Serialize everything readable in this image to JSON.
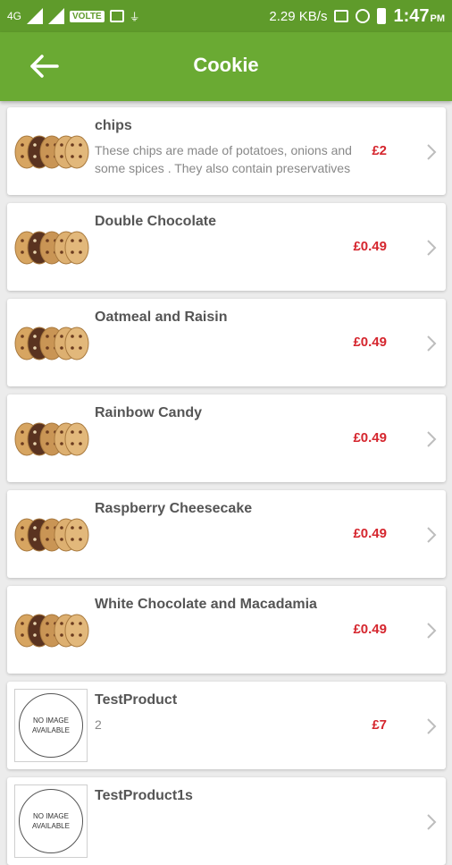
{
  "status_bar": {
    "network": "4G",
    "volte": "VOLTE",
    "speed": "2.29 KB/s",
    "time": "1:47",
    "ampm": "PM"
  },
  "app_bar": {
    "title": "Cookie"
  },
  "products": [
    {
      "name": "chips",
      "description": "These chips are made of potatoes, onions and some spices . They also contain preservatives",
      "price": "£2",
      "image": "cookie"
    },
    {
      "name": "Double Chocolate",
      "description": "",
      "price": "£0.49",
      "image": "cookie"
    },
    {
      "name": "Oatmeal and Raisin",
      "description": "",
      "price": "£0.49",
      "image": "cookie"
    },
    {
      "name": "Rainbow Candy",
      "description": "",
      "price": "£0.49",
      "image": "cookie"
    },
    {
      "name": "Raspberry Cheesecake",
      "description": "",
      "price": "£0.49",
      "image": "cookie"
    },
    {
      "name": "White Chocolate and Macadamia",
      "description": "",
      "price": "£0.49",
      "image": "cookie"
    },
    {
      "name": "TestProduct",
      "description": "2",
      "price": "£7",
      "image": "no-image"
    },
    {
      "name": "TestProduct1s",
      "description": "",
      "price": "",
      "image": "no-image"
    }
  ],
  "no_image_label": "NO IMAGE AVAILABLE",
  "colors": {
    "accent": "#6aaa33",
    "status": "#5f9b2b",
    "price": "#d5262e"
  }
}
